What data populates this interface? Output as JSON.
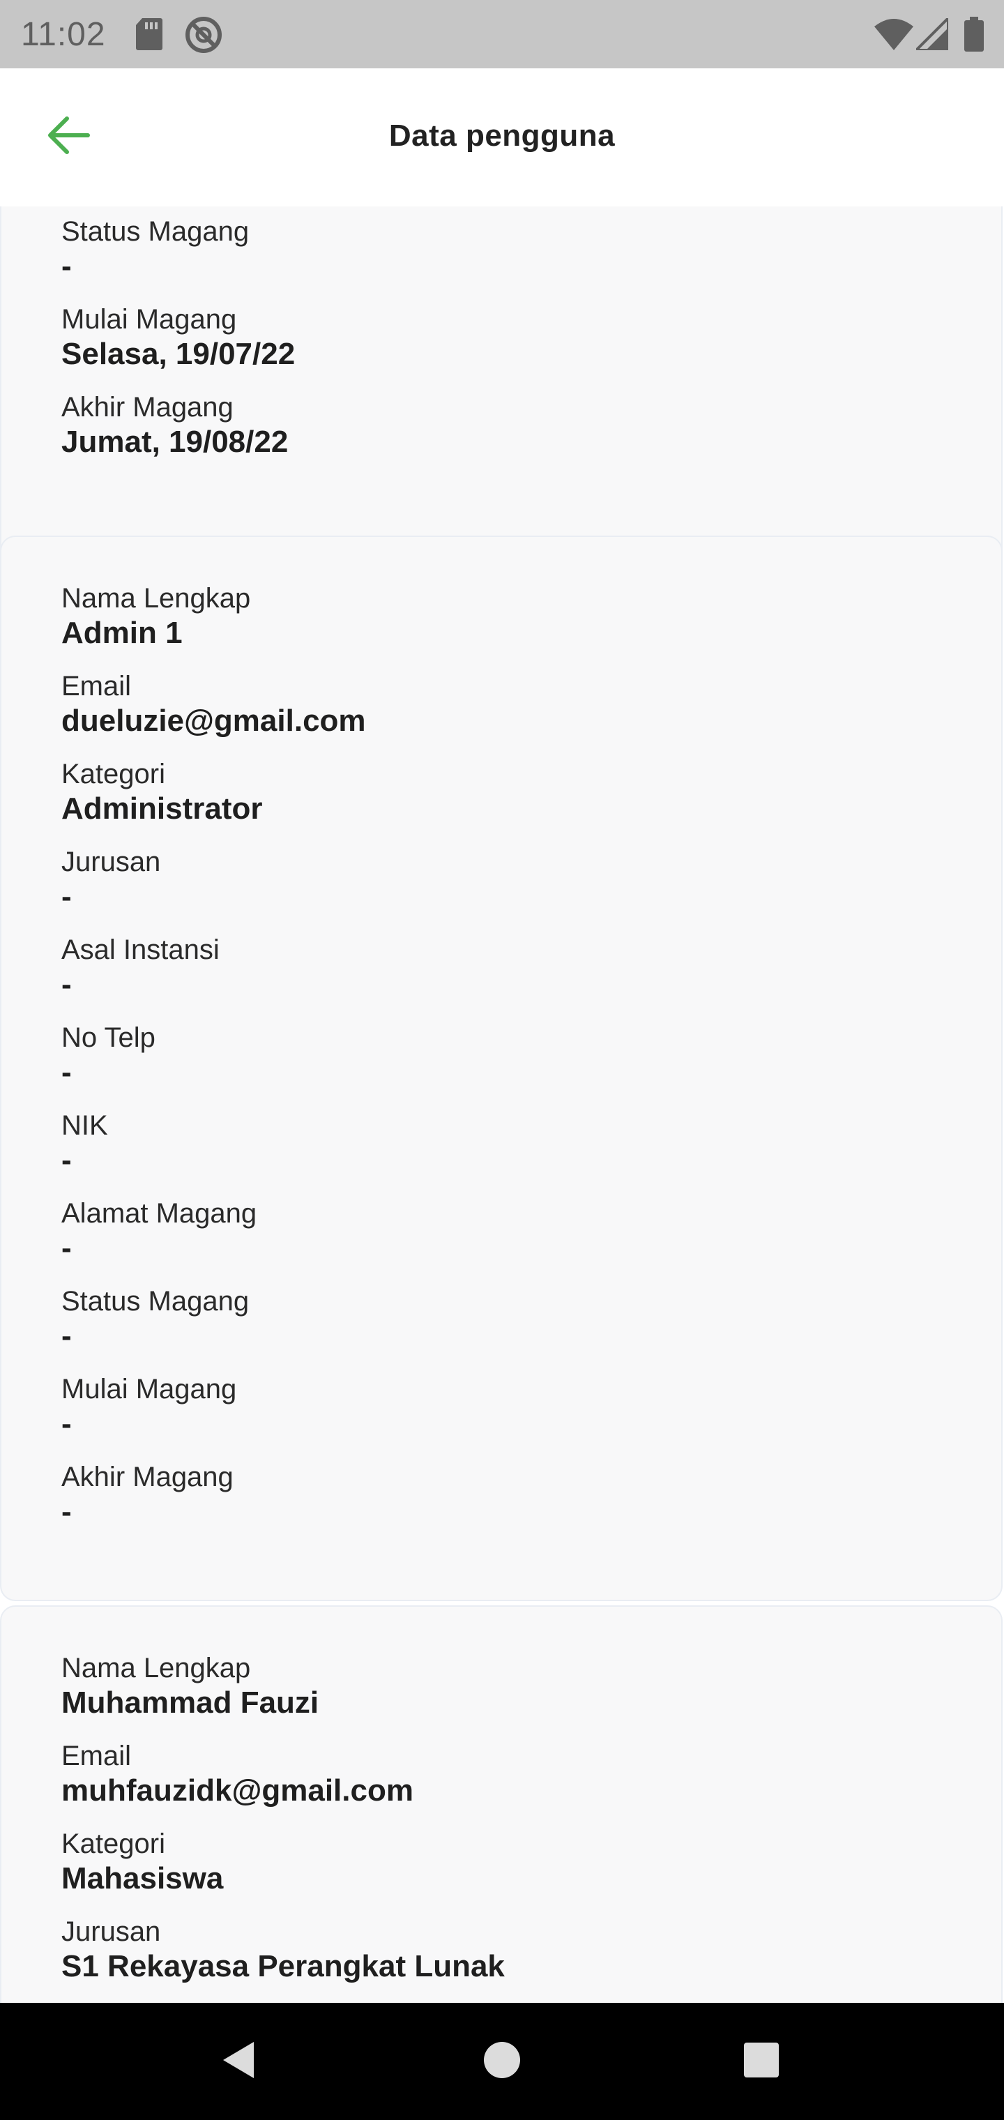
{
  "status_bar": {
    "time": "11:02",
    "left_icons": [
      "sd-card-icon",
      "no-sync-icon"
    ],
    "right_icons": [
      "wifi-icon",
      "signal-icon",
      "battery-icon"
    ]
  },
  "app_bar": {
    "title": "Data pengguna",
    "back_icon": "arrow-left-icon",
    "accent_color": "#4caf50"
  },
  "cards": [
    {
      "fields": [
        {
          "label": "Status Magang",
          "value": "-"
        },
        {
          "label": "Mulai Magang",
          "value": "Selasa, 19/07/22"
        },
        {
          "label": "Akhir Magang",
          "value": "Jumat, 19/08/22"
        }
      ]
    },
    {
      "fields": [
        {
          "label": "Nama Lengkap",
          "value": "Admin 1"
        },
        {
          "label": "Email",
          "value": "dueluzie@gmail.com"
        },
        {
          "label": "Kategori",
          "value": "Administrator"
        },
        {
          "label": "Jurusan",
          "value": "-"
        },
        {
          "label": "Asal Instansi",
          "value": "-"
        },
        {
          "label": "No Telp",
          "value": "-"
        },
        {
          "label": "NIK",
          "value": "-"
        },
        {
          "label": "Alamat Magang",
          "value": "-"
        },
        {
          "label": "Status Magang",
          "value": "-"
        },
        {
          "label": "Mulai Magang",
          "value": "-"
        },
        {
          "label": "Akhir Magang",
          "value": "-"
        }
      ]
    },
    {
      "fields": [
        {
          "label": "Nama Lengkap",
          "value": "Muhammad Fauzi"
        },
        {
          "label": "Email",
          "value": "muhfauzidk@gmail.com"
        },
        {
          "label": "Kategori",
          "value": "Mahasiswa"
        },
        {
          "label": "Jurusan",
          "value": "S1 Rekayasa Perangkat Lunak"
        }
      ]
    }
  ],
  "nav_bar": {
    "icons": [
      "back-triangle-icon",
      "home-circle-icon",
      "recents-square-icon"
    ]
  }
}
